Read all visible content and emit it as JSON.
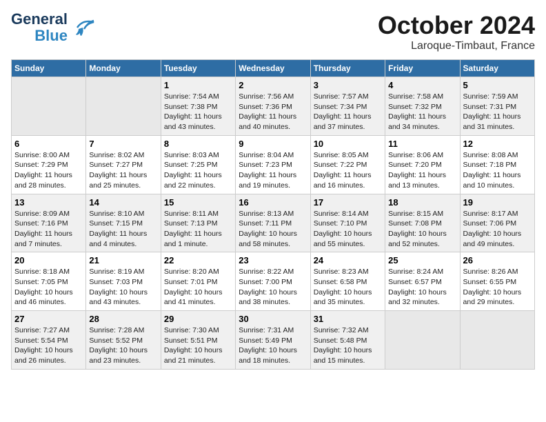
{
  "header": {
    "logo_line1": "General",
    "logo_line2": "Blue",
    "month": "October 2024",
    "location": "Laroque-Timbaut, France"
  },
  "days_of_week": [
    "Sunday",
    "Monday",
    "Tuesday",
    "Wednesday",
    "Thursday",
    "Friday",
    "Saturday"
  ],
  "weeks": [
    [
      {
        "day": "",
        "info": ""
      },
      {
        "day": "",
        "info": ""
      },
      {
        "day": "1",
        "info": "Sunrise: 7:54 AM\nSunset: 7:38 PM\nDaylight: 11 hours and 43 minutes."
      },
      {
        "day": "2",
        "info": "Sunrise: 7:56 AM\nSunset: 7:36 PM\nDaylight: 11 hours and 40 minutes."
      },
      {
        "day": "3",
        "info": "Sunrise: 7:57 AM\nSunset: 7:34 PM\nDaylight: 11 hours and 37 minutes."
      },
      {
        "day": "4",
        "info": "Sunrise: 7:58 AM\nSunset: 7:32 PM\nDaylight: 11 hours and 34 minutes."
      },
      {
        "day": "5",
        "info": "Sunrise: 7:59 AM\nSunset: 7:31 PM\nDaylight: 11 hours and 31 minutes."
      }
    ],
    [
      {
        "day": "6",
        "info": "Sunrise: 8:00 AM\nSunset: 7:29 PM\nDaylight: 11 hours and 28 minutes."
      },
      {
        "day": "7",
        "info": "Sunrise: 8:02 AM\nSunset: 7:27 PM\nDaylight: 11 hours and 25 minutes."
      },
      {
        "day": "8",
        "info": "Sunrise: 8:03 AM\nSunset: 7:25 PM\nDaylight: 11 hours and 22 minutes."
      },
      {
        "day": "9",
        "info": "Sunrise: 8:04 AM\nSunset: 7:23 PM\nDaylight: 11 hours and 19 minutes."
      },
      {
        "day": "10",
        "info": "Sunrise: 8:05 AM\nSunset: 7:22 PM\nDaylight: 11 hours and 16 minutes."
      },
      {
        "day": "11",
        "info": "Sunrise: 8:06 AM\nSunset: 7:20 PM\nDaylight: 11 hours and 13 minutes."
      },
      {
        "day": "12",
        "info": "Sunrise: 8:08 AM\nSunset: 7:18 PM\nDaylight: 11 hours and 10 minutes."
      }
    ],
    [
      {
        "day": "13",
        "info": "Sunrise: 8:09 AM\nSunset: 7:16 PM\nDaylight: 11 hours and 7 minutes."
      },
      {
        "day": "14",
        "info": "Sunrise: 8:10 AM\nSunset: 7:15 PM\nDaylight: 11 hours and 4 minutes."
      },
      {
        "day": "15",
        "info": "Sunrise: 8:11 AM\nSunset: 7:13 PM\nDaylight: 11 hours and 1 minute."
      },
      {
        "day": "16",
        "info": "Sunrise: 8:13 AM\nSunset: 7:11 PM\nDaylight: 10 hours and 58 minutes."
      },
      {
        "day": "17",
        "info": "Sunrise: 8:14 AM\nSunset: 7:10 PM\nDaylight: 10 hours and 55 minutes."
      },
      {
        "day": "18",
        "info": "Sunrise: 8:15 AM\nSunset: 7:08 PM\nDaylight: 10 hours and 52 minutes."
      },
      {
        "day": "19",
        "info": "Sunrise: 8:17 AM\nSunset: 7:06 PM\nDaylight: 10 hours and 49 minutes."
      }
    ],
    [
      {
        "day": "20",
        "info": "Sunrise: 8:18 AM\nSunset: 7:05 PM\nDaylight: 10 hours and 46 minutes."
      },
      {
        "day": "21",
        "info": "Sunrise: 8:19 AM\nSunset: 7:03 PM\nDaylight: 10 hours and 43 minutes."
      },
      {
        "day": "22",
        "info": "Sunrise: 8:20 AM\nSunset: 7:01 PM\nDaylight: 10 hours and 41 minutes."
      },
      {
        "day": "23",
        "info": "Sunrise: 8:22 AM\nSunset: 7:00 PM\nDaylight: 10 hours and 38 minutes."
      },
      {
        "day": "24",
        "info": "Sunrise: 8:23 AM\nSunset: 6:58 PM\nDaylight: 10 hours and 35 minutes."
      },
      {
        "day": "25",
        "info": "Sunrise: 8:24 AM\nSunset: 6:57 PM\nDaylight: 10 hours and 32 minutes."
      },
      {
        "day": "26",
        "info": "Sunrise: 8:26 AM\nSunset: 6:55 PM\nDaylight: 10 hours and 29 minutes."
      }
    ],
    [
      {
        "day": "27",
        "info": "Sunrise: 7:27 AM\nSunset: 5:54 PM\nDaylight: 10 hours and 26 minutes."
      },
      {
        "day": "28",
        "info": "Sunrise: 7:28 AM\nSunset: 5:52 PM\nDaylight: 10 hours and 23 minutes."
      },
      {
        "day": "29",
        "info": "Sunrise: 7:30 AM\nSunset: 5:51 PM\nDaylight: 10 hours and 21 minutes."
      },
      {
        "day": "30",
        "info": "Sunrise: 7:31 AM\nSunset: 5:49 PM\nDaylight: 10 hours and 18 minutes."
      },
      {
        "day": "31",
        "info": "Sunrise: 7:32 AM\nSunset: 5:48 PM\nDaylight: 10 hours and 15 minutes."
      },
      {
        "day": "",
        "info": ""
      },
      {
        "day": "",
        "info": ""
      }
    ]
  ]
}
